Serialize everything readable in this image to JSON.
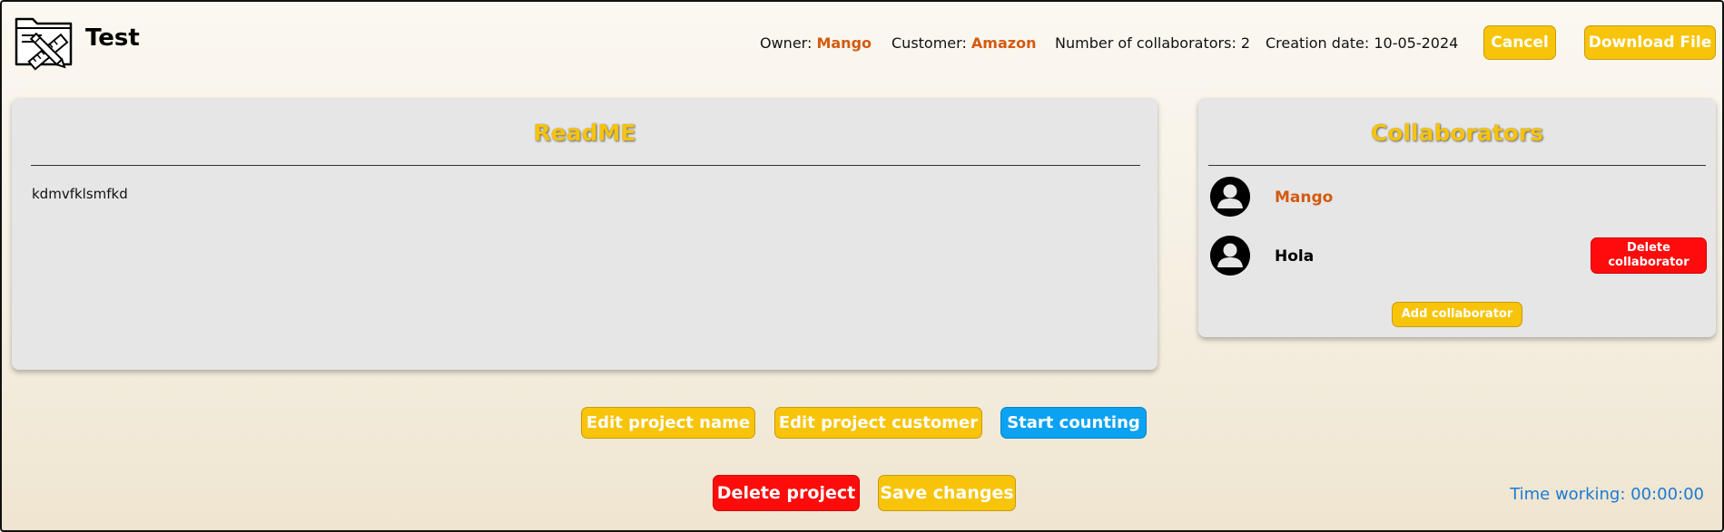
{
  "header": {
    "project_name": "Test",
    "owner_label": "Owner:",
    "owner_value": "Mango",
    "customer_label": "Customer:",
    "customer_value": "Amazon",
    "collaborators_count_text": "Number of collaborators: 2",
    "creation_date_text": "Creation date: 10-05-2024",
    "cancel_label": "Cancel",
    "download_label": "Download File"
  },
  "readme": {
    "title": "ReadME",
    "content": "kdmvfklsmfkd"
  },
  "collaborators": {
    "title": "Collaborators",
    "items": [
      {
        "name": "Mango",
        "is_owner": true
      },
      {
        "name": "Hola",
        "is_owner": false,
        "delete_label": "Delete collaborator"
      }
    ],
    "add_label": "Add collaborator"
  },
  "actions": {
    "edit_name_label": "Edit project name",
    "edit_customer_label": "Edit project customer",
    "start_counting_label": "Start counting",
    "delete_project_label": "Delete project",
    "save_changes_label": "Save changes"
  },
  "timer": {
    "label": "Time working:",
    "value": "00:00:00"
  },
  "colors": {
    "accent_yellow": "#f8c40a",
    "danger_red": "#ff0b0b",
    "info_blue": "#0ba2f2",
    "owner_orange": "#d45a10",
    "timer_blue": "#1a7ad6"
  },
  "icons": {
    "logo": "folder-with-ruler-and-pencil-icon",
    "avatar": "user-avatar-icon"
  }
}
